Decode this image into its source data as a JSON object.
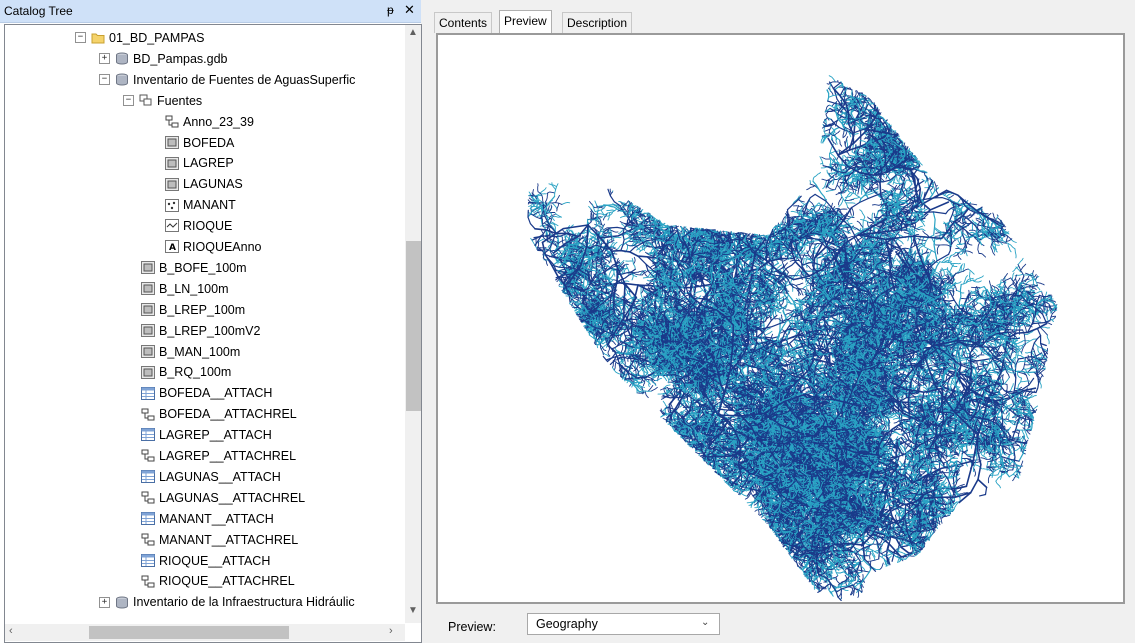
{
  "catalog": {
    "title": "Catalog Tree",
    "pin_glyph": "ᵽ",
    "close_glyph": "✕",
    "tree": [
      {
        "label": "01_BD_PAMPAS",
        "icon": "folder-icon",
        "expander": "−"
      },
      {
        "label": "BD_Pampas.gdb",
        "icon": "geodatabase-icon",
        "expander": "+"
      },
      {
        "label": "Inventario de Fuentes de AguasSuperfic",
        "icon": "geodatabase-icon",
        "expander": "−"
      },
      {
        "label": "Fuentes",
        "icon": "feature-dataset-icon",
        "expander": "−"
      },
      {
        "label": "Anno_23_39",
        "icon": "relationship-class-icon",
        "expander": ""
      },
      {
        "label": "BOFEDA",
        "icon": "polygon-feature-class-icon",
        "expander": ""
      },
      {
        "label": "LAGREP",
        "icon": "polygon-feature-class-icon",
        "expander": ""
      },
      {
        "label": "LAGUNAS",
        "icon": "polygon-feature-class-icon",
        "expander": ""
      },
      {
        "label": "MANANT",
        "icon": "point-feature-class-icon",
        "expander": ""
      },
      {
        "label": "RIOQUE",
        "icon": "line-feature-class-icon",
        "expander": ""
      },
      {
        "label": "RIOQUEAnno",
        "icon": "annotation-class-icon",
        "expander": ""
      },
      {
        "label": "B_BOFE_100m",
        "icon": "polygon-feature-class-icon",
        "expander": ""
      },
      {
        "label": "B_LN_100m",
        "icon": "polygon-feature-class-icon",
        "expander": ""
      },
      {
        "label": "B_LREP_100m",
        "icon": "polygon-feature-class-icon",
        "expander": ""
      },
      {
        "label": "B_LREP_100mV2",
        "icon": "polygon-feature-class-icon",
        "expander": ""
      },
      {
        "label": "B_MAN_100m",
        "icon": "polygon-feature-class-icon",
        "expander": ""
      },
      {
        "label": "B_RQ_100m",
        "icon": "polygon-feature-class-icon",
        "expander": ""
      },
      {
        "label": "BOFEDA__ATTACH",
        "icon": "table-icon",
        "expander": ""
      },
      {
        "label": "BOFEDA__ATTACHREL",
        "icon": "relationship-class-icon",
        "expander": ""
      },
      {
        "label": "LAGREP__ATTACH",
        "icon": "table-icon",
        "expander": ""
      },
      {
        "label": "LAGREP__ATTACHREL",
        "icon": "relationship-class-icon",
        "expander": ""
      },
      {
        "label": "LAGUNAS__ATTACH",
        "icon": "table-icon",
        "expander": ""
      },
      {
        "label": "LAGUNAS__ATTACHREL",
        "icon": "relationship-class-icon",
        "expander": ""
      },
      {
        "label": "MANANT__ATTACH",
        "icon": "table-icon",
        "expander": ""
      },
      {
        "label": "MANANT__ATTACHREL",
        "icon": "relationship-class-icon",
        "expander": ""
      },
      {
        "label": "RIOQUE__ATTACH",
        "icon": "table-icon",
        "expander": ""
      },
      {
        "label": "RIOQUE__ATTACHREL",
        "icon": "relationship-class-icon",
        "expander": ""
      },
      {
        "label": "Inventario de la Infraestructura Hidráulic",
        "icon": "geodatabase-icon",
        "expander": "+"
      }
    ]
  },
  "tabs": [
    {
      "label": "Contents",
      "active": false
    },
    {
      "label": "Preview",
      "active": true
    },
    {
      "label": "Description",
      "active": false
    }
  ],
  "preview": {
    "label": "Preview:",
    "selected": "Geography",
    "colors": {
      "major_streams": "#1a3a8a",
      "minor_streams": "#2aa3c4"
    }
  },
  "scrollbar_glyphs": {
    "up": "▲",
    "down": "▼",
    "left": "‹",
    "right": "›"
  }
}
